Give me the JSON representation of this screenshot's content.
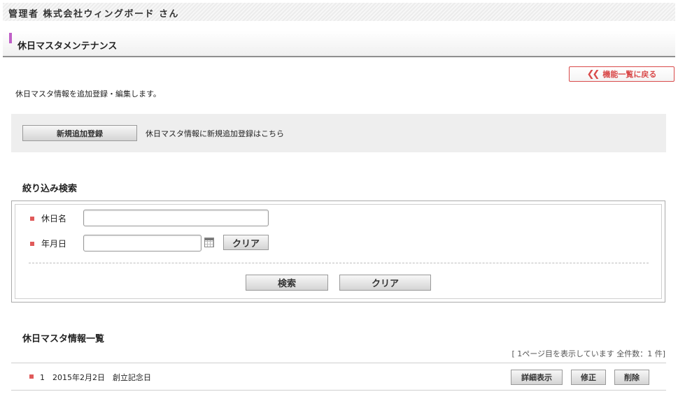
{
  "header": {
    "user_label": "管理者 株式会社ウィングボード さん"
  },
  "page": {
    "title": "休日マスタメンテナンス",
    "back_label": "機能一覧に戻る",
    "description": "休日マスタ情報を追加登録・編集します。"
  },
  "new_entry": {
    "button_label": "新規追加登録",
    "hint": "休日マスタ情報に新規追加登録はこちら"
  },
  "search": {
    "title": "絞り込み検索",
    "fields": {
      "holiday_name_label": "休日名",
      "holiday_name_value": "",
      "date_label": "年月日",
      "date_value": ""
    },
    "date_clear_label": "クリア",
    "search_label": "検索",
    "clear_label": "クリア"
  },
  "list": {
    "title": "休日マスタ情報一覧",
    "page_info": "[ 1ページ目を表示しています 全件数：1 件]",
    "rows": [
      {
        "no": "1",
        "date": "2015年2月2日",
        "name": "創立記念日"
      }
    ],
    "actions": {
      "detail": "詳細表示",
      "edit": "修正",
      "delete": "削除"
    }
  },
  "colors": {
    "accent_red": "#d94a4a",
    "title_mark": "#c060c8",
    "bullet": "#e05a5a"
  }
}
